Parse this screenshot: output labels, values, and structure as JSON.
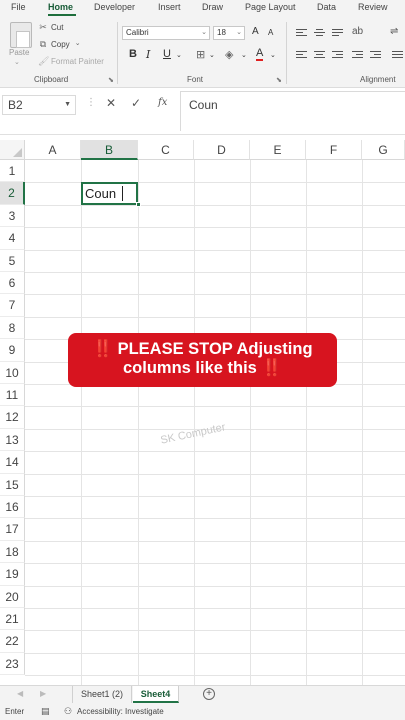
{
  "tabs": [
    {
      "label": "File",
      "active": false
    },
    {
      "label": "Home",
      "active": true
    },
    {
      "label": "Developer",
      "active": false
    },
    {
      "label": "Insert",
      "active": false
    },
    {
      "label": "Draw",
      "active": false
    },
    {
      "label": "Page Layout",
      "active": false
    },
    {
      "label": "Data",
      "active": false
    },
    {
      "label": "Review",
      "active": false
    }
  ],
  "clipboard": {
    "paste_label": "Paste",
    "cut_label": "Cut",
    "copy_label": "Copy",
    "format_painter_label": "Format Painter",
    "group_label": "Clipboard"
  },
  "font": {
    "name": "Calibri",
    "size": "18",
    "bold": "B",
    "italic": "I",
    "underline": "U",
    "grow": "A",
    "shrink": "A",
    "font_color": "A",
    "group_label": "Font"
  },
  "alignment": {
    "group_label": "Alignment"
  },
  "formula_bar": {
    "name_box": "B2",
    "fx": "fx",
    "content": "Coun"
  },
  "columns": [
    "A",
    "B",
    "C",
    "D",
    "E",
    "F",
    "G"
  ],
  "selected_column": "B",
  "rows": [
    "1",
    "2",
    "3",
    "4",
    "5",
    "6",
    "7",
    "8",
    "9",
    "10",
    "11",
    "12",
    "13",
    "14",
    "15",
    "16",
    "17",
    "18",
    "19",
    "20",
    "21",
    "22",
    "23"
  ],
  "selected_row": "2",
  "active_cell": {
    "ref": "B2",
    "text": "Coun"
  },
  "banner": {
    "line1": "PLEASE STOP Adjusting",
    "line2": "columns like this",
    "bang": "‼️",
    "color": "#d7141f"
  },
  "watermark": "SK Computer",
  "sheets": [
    {
      "label": "Sheet1 (2)",
      "active": false
    },
    {
      "label": "Sheet4",
      "active": true
    }
  ],
  "status": {
    "mode": "Enter",
    "accessibility": "Accessibility: Investigate"
  },
  "colors": {
    "accent": "#217346",
    "ribbon_bg": "#f3f3f3"
  }
}
